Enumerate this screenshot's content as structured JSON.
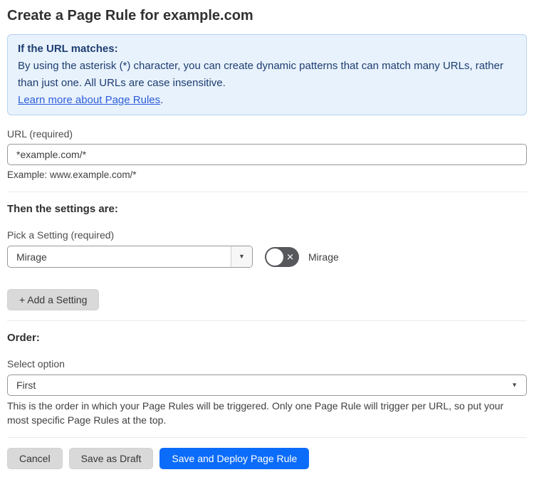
{
  "page": {
    "title": "Create a Page Rule for example.com"
  },
  "info_box": {
    "heading": "If the URL matches:",
    "body": "By using the asterisk (*) character, you can create dynamic patterns that can match many URLs, rather than just one. All URLs are case insensitive.",
    "link_label": "Learn more about Page Rules",
    "link_suffix": "."
  },
  "url_field": {
    "label": "URL (required)",
    "value": "*example.com/*",
    "helper": "Example: www.example.com/*"
  },
  "settings_section": {
    "heading": "Then the settings are:",
    "picker_label": "Pick a Setting (required)",
    "picker_value": "Mirage",
    "toggle_state": "off",
    "toggle_label": "Mirage",
    "add_setting_label": "+ Add a Setting"
  },
  "order_section": {
    "heading": "Order:",
    "select_label": "Select option",
    "select_value": "First",
    "helper": "This is the order in which your Page Rules will be triggered. Only one Page Rule will trigger per URL, so put your most specific Page Rules at the top."
  },
  "footer": {
    "cancel_label": "Cancel",
    "save_draft_label": "Save as Draft",
    "save_deploy_label": "Save and Deploy Page Rule"
  },
  "icons": {
    "chevron_down": "▼",
    "toggle_x": "✕"
  },
  "colors": {
    "info_bg": "#e8f2fd",
    "info_border": "#b7d3f2",
    "info_text": "#1d3d70",
    "link": "#2d5ed9",
    "primary_button": "#0c6cfa",
    "toggle_off": "#56585c",
    "gray_button": "#d9d9d9"
  }
}
